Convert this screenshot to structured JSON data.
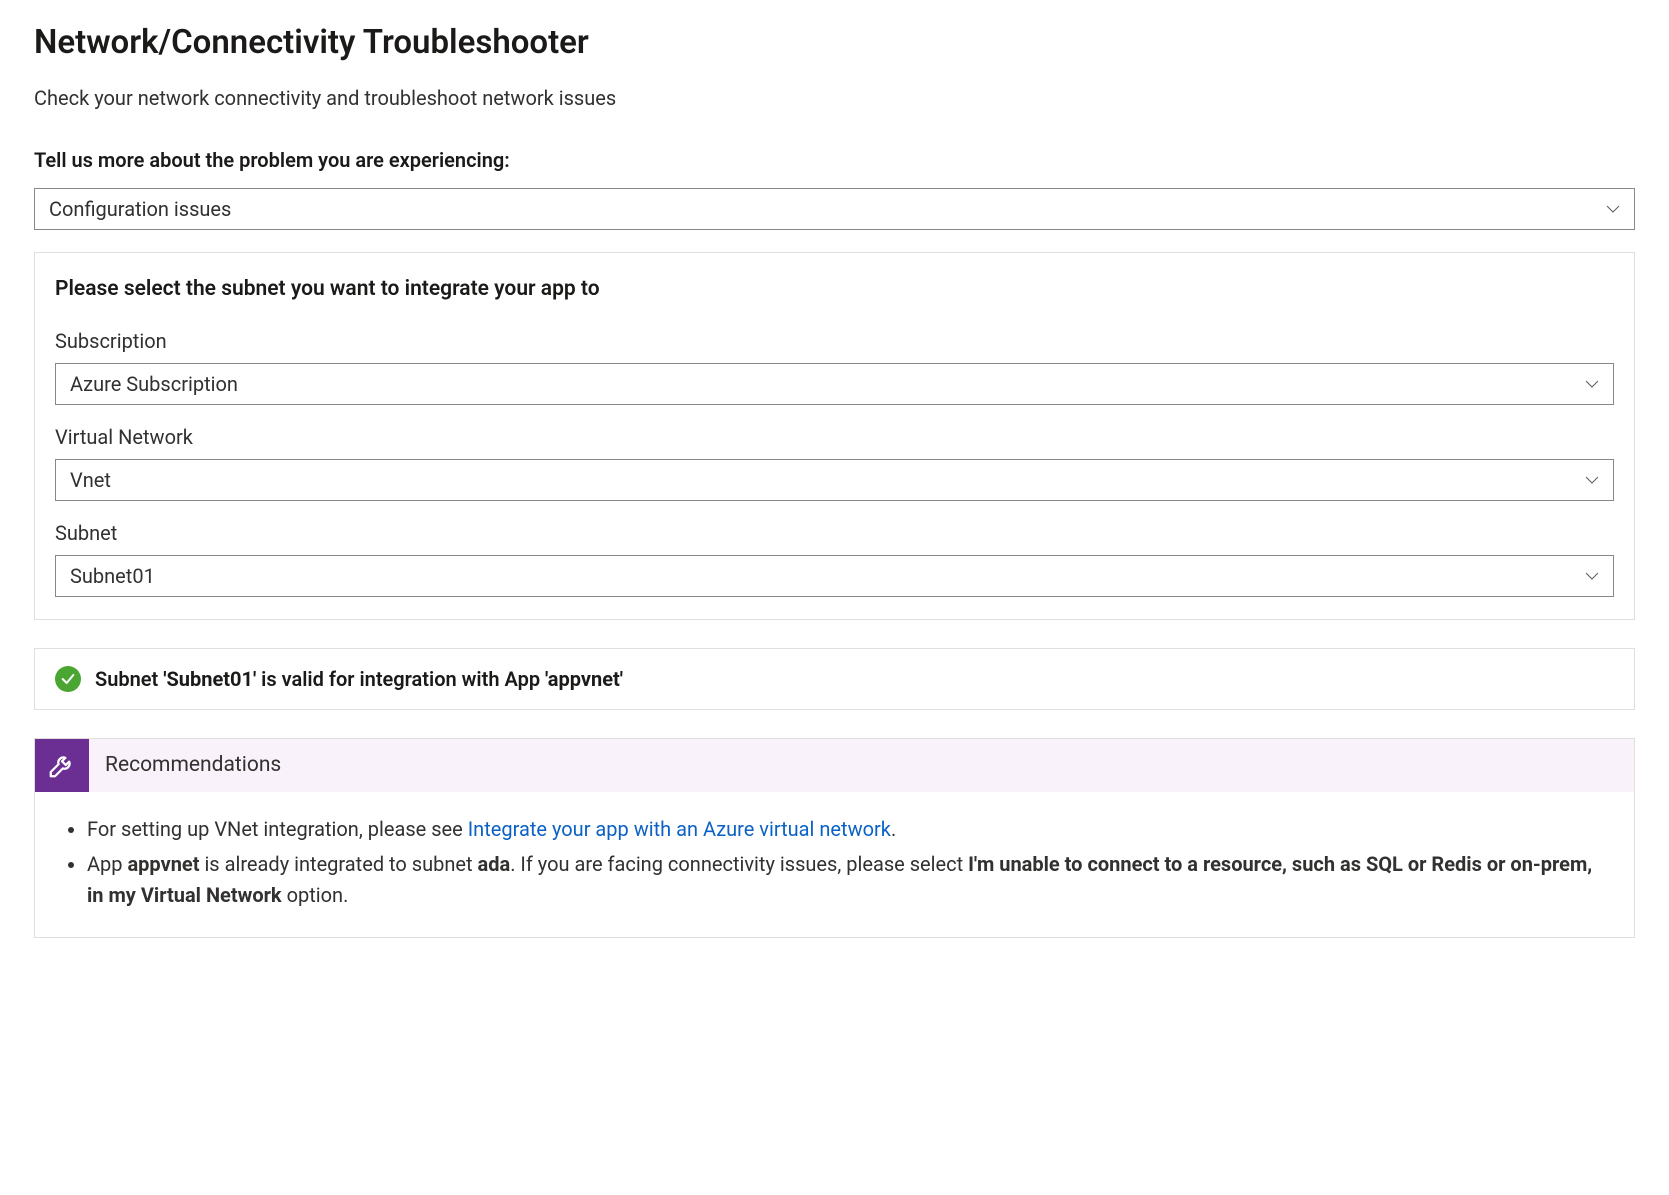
{
  "page": {
    "title": "Network/Connectivity Troubleshooter",
    "subtitle": "Check your network connectivity and troubleshoot network issues",
    "prompt": "Tell us more about the problem you are experiencing:"
  },
  "problem_dropdown": {
    "value": "Configuration issues"
  },
  "subnet_card": {
    "heading": "Please select the subnet you want to integrate your app to",
    "subscription": {
      "label": "Subscription",
      "value": "Azure Subscription"
    },
    "vnet": {
      "label": "Virtual Network",
      "value": "Vnet"
    },
    "subnet": {
      "label": "Subnet",
      "value": "Subnet01"
    }
  },
  "status": {
    "prefix": "Subnet ",
    "q1": "'Subnet01'",
    "mid": " is valid for integration with App ",
    "q2": "'appvnet'"
  },
  "recommendations": {
    "title": "Recommendations",
    "item1": {
      "a": "For setting up VNet integration, please see ",
      "link": "Integrate your app with an Azure virtual network",
      "b": "."
    },
    "item2": {
      "a": "App ",
      "app": "appvnet",
      "b": " is already integrated to subnet ",
      "subnet": "ada",
      "c": ". If you are facing connectivity issues, please select ",
      "bold": "I'm unable to connect to a resource, such as SQL or Redis or on-prem, in my Virtual Network",
      "d": " option."
    }
  }
}
